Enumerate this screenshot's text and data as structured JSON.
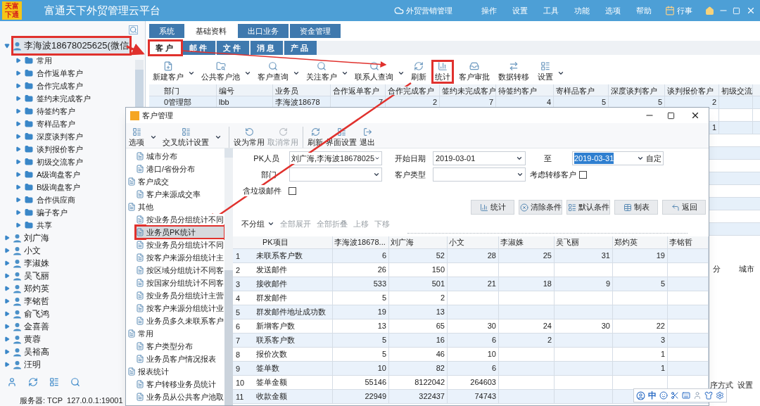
{
  "title_bar": {
    "logo": [
      "天富",
      "下通"
    ],
    "title": "富通天下外贸管理云平台",
    "cloud_link": "外贸营销管理",
    "menu": [
      "操作",
      "设置",
      "工具",
      "功能",
      "选项",
      "帮助"
    ],
    "calendar": "行事"
  },
  "sidebar": {
    "users": [
      {
        "label": "李海波18678025625(微信",
        "expanded": true,
        "annotated": true,
        "children": [
          {
            "label": "常用",
            "expanded": false
          },
          {
            "label": "合作返单客户",
            "expanded": false
          },
          {
            "label": "合作完成客户",
            "expanded": false
          },
          {
            "label": "签约未完成客户",
            "expanded": false
          },
          {
            "label": "待签约客户",
            "expanded": false
          },
          {
            "label": "寄样品客户",
            "expanded": false
          },
          {
            "label": "深度谈判客户",
            "expanded": false
          },
          {
            "label": "谈判报价客户",
            "expanded": false
          },
          {
            "label": "初级交流客户",
            "expanded": false
          },
          {
            "label": "A级询盘客户",
            "expanded": false
          },
          {
            "label": "B级询盘客户",
            "expanded": false
          },
          {
            "label": "合作供应商",
            "expanded": false
          },
          {
            "label": "骗子客户",
            "expanded": false
          },
          {
            "label": "共享",
            "expanded": false
          }
        ]
      },
      {
        "label": "刘广海",
        "expanded": false,
        "annotated": false
      },
      {
        "label": "小文",
        "expanded": false,
        "annotated": false
      },
      {
        "label": "李淑姝",
        "expanded": false,
        "annotated": false
      },
      {
        "label": "吴飞丽",
        "expanded": false,
        "annotated": false
      },
      {
        "label": "郑灼英",
        "expanded": false,
        "annotated": false
      },
      {
        "label": "李铭哲",
        "expanded": false,
        "annotated": false
      },
      {
        "label": "俞飞鸿",
        "expanded": false,
        "annotated": false
      },
      {
        "label": "金喜善",
        "expanded": false,
        "annotated": false
      },
      {
        "label": "黄蓉",
        "expanded": false,
        "annotated": false
      },
      {
        "label": "吴裕高",
        "expanded": false,
        "annotated": false
      },
      {
        "label": "汪明",
        "expanded": false,
        "annotated": false
      }
    ],
    "server": "服务器: TCP  127.0.0.1:19001"
  },
  "main_tabs": [
    {
      "label": "系统",
      "selected": false
    },
    {
      "label": "基础资料",
      "selected": true
    },
    {
      "label": "出口业务",
      "selected": false
    },
    {
      "label": "资金管理",
      "selected": false
    }
  ],
  "sub_tabs": [
    {
      "label": "客户",
      "selected": true,
      "annotated": true
    },
    {
      "label": "邮件",
      "selected": false,
      "annotated": false
    },
    {
      "label": "文件",
      "selected": false,
      "annotated": false
    },
    {
      "label": "消息",
      "selected": false,
      "annotated": false
    },
    {
      "label": "产品",
      "selected": false,
      "annotated": false
    }
  ],
  "toolbar": [
    {
      "label": "新建客户",
      "dropdown": true,
      "annotated": false
    },
    {
      "label": "公共客户池",
      "dropdown": true,
      "annotated": false
    },
    {
      "label": "客户查询",
      "dropdown": true,
      "annotated": false
    },
    {
      "label": "关注客户",
      "dropdown": true,
      "annotated": false
    },
    {
      "label": "联系人查询",
      "dropdown": true,
      "annotated": false
    },
    {
      "label": "刷新",
      "dropdown": false,
      "annotated": false
    },
    {
      "label": "统计",
      "dropdown": false,
      "annotated": true
    },
    {
      "label": "客户审批",
      "dropdown": false,
      "annotated": false
    },
    {
      "label": "数据转移",
      "dropdown": false,
      "annotated": false
    },
    {
      "label": "设置",
      "dropdown": true,
      "annotated": false
    }
  ],
  "table": {
    "columns": [
      "部门",
      "编号",
      "业务员",
      "合作返单客户",
      "合作完成客户",
      "签约未完成客户",
      "待签约客户",
      "寄样品客户",
      "深度谈判客户",
      "谈判报价客户",
      "初级交流"
    ],
    "rows": [
      {
        "cells": [
          "0管理部",
          "lbb",
          "李海波18678",
          "7",
          "2",
          "7",
          "4",
          "5",
          "5",
          "2",
          null
        ]
      },
      {
        "cells": [
          null,
          null,
          null,
          null,
          null,
          null,
          null,
          null,
          null,
          null,
          null
        ]
      },
      {
        "cells": [
          null,
          null,
          null,
          null,
          null,
          null,
          null,
          null,
          null,
          "1",
          null
        ]
      }
    ]
  },
  "lower_panel": {
    "columns": [
      "分",
      "城市"
    ],
    "footer": [
      "序方式",
      "设置"
    ]
  },
  "dialog": {
    "title": "客户管理",
    "toolbar": [
      {
        "label": "选项",
        "dropdown": true,
        "disabled": false,
        "separator": false
      },
      {
        "label": "交叉统计设置",
        "dropdown": true,
        "disabled": false,
        "separator": false
      },
      {
        "label": "设为常用",
        "dropdown": false,
        "disabled": false,
        "separator": true
      },
      {
        "label": "取消常用",
        "dropdown": false,
        "disabled": true,
        "separator": false
      },
      {
        "label": "刷新",
        "dropdown": false,
        "disabled": false,
        "separator": true
      },
      {
        "label": "界面设置",
        "dropdown": false,
        "disabled": false,
        "separator": false
      },
      {
        "label": "退出",
        "dropdown": false,
        "disabled": false,
        "separator": false
      }
    ],
    "report_tree": [
      {
        "children": [
          {
            "label": "城市分布",
            "selected": false,
            "annotated": false
          },
          {
            "label": "港口/省份分布",
            "selected": false,
            "annotated": false
          }
        ]
      },
      {
        "label": "客户成交",
        "children": [
          {
            "label": "客户来源成交率",
            "selected": false,
            "annotated": false
          }
        ]
      },
      {
        "label": "其他",
        "children": [
          {
            "label": "按业务员分组统计不同",
            "selected": false,
            "annotated": false
          },
          {
            "label": "业务员PK统计",
            "selected": true,
            "annotated": true
          },
          {
            "label": "按业务员分组统计不同",
            "selected": false,
            "annotated": false
          },
          {
            "label": "按客户来源分组统计主",
            "selected": false,
            "annotated": false
          },
          {
            "label": "按区域分组统计不同客",
            "selected": false,
            "annotated": false
          },
          {
            "label": "按国家分组统计不同客",
            "selected": false,
            "annotated": false
          },
          {
            "label": "按业务员分组统计主营",
            "selected": false,
            "annotated": false
          },
          {
            "label": "按客户来源分组统计业",
            "selected": false,
            "annotated": false
          },
          {
            "label": "业务员多久未联系客户",
            "selected": false,
            "annotated": false
          }
        ]
      },
      {
        "label": "常用",
        "children": [
          {
            "label": "客户类型分布",
            "selected": false,
            "annotated": false
          },
          {
            "label": "业务员客户情况报表",
            "selected": false,
            "annotated": false
          }
        ]
      },
      {
        "label": "报表统计",
        "children": [
          {
            "label": "客户转移业务员统计",
            "selected": false,
            "annotated": false
          },
          {
            "label": "业务员从公共客户池取",
            "selected": false,
            "annotated": false
          }
        ]
      }
    ],
    "form": {
      "pk_label": "PK人员",
      "pk_value": "刘广海,李海波18678025",
      "start_label": "开始日期",
      "start_value": "2019-03-01",
      "end_label": "至",
      "end_value": "2019-03-31",
      "end_selected": true,
      "custom": "自定",
      "dept_label": "部门",
      "type_label": "客户类型",
      "transfer_label": "考虑转移客户",
      "transfer_checked": false,
      "spam_label": "含垃圾邮件",
      "spam_checked": false
    },
    "buttons": [
      "统计",
      "清除条件",
      "默认条件",
      "制表",
      "返回"
    ],
    "group_bar": [
      {
        "label": "不分组",
        "dropdown": true,
        "disabled": false
      },
      {
        "label": "全部展开",
        "dropdown": false,
        "disabled": true
      },
      {
        "label": "全部折叠",
        "dropdown": false,
        "disabled": true
      },
      {
        "label": "上移",
        "dropdown": false,
        "disabled": true
      },
      {
        "label": "下移",
        "dropdown": false,
        "disabled": true
      }
    ],
    "grid": {
      "columns": [
        "PK项目",
        "李海波18678...",
        "刘广海",
        "小文",
        "李淑姝",
        "吴飞丽",
        "郑灼英",
        "李铭哲"
      ],
      "rows": [
        {
          "num": "1",
          "cells": [
            "未联系客户数",
            "6",
            "52",
            "28",
            "25",
            "31",
            "19",
            null
          ]
        },
        {
          "num": "2",
          "cells": [
            "发送邮件",
            "26",
            "150",
            null,
            null,
            null,
            null,
            null
          ]
        },
        {
          "num": "3",
          "cells": [
            "接收邮件",
            "533",
            "501",
            "21",
            "18",
            "9",
            "5",
            null
          ]
        },
        {
          "num": "4",
          "cells": [
            "群发邮件",
            "5",
            "2",
            null,
            null,
            null,
            null,
            null
          ]
        },
        {
          "num": "5",
          "cells": [
            "群发邮件地址成功数",
            "19",
            "13",
            null,
            null,
            null,
            null,
            null
          ]
        },
        {
          "num": "6",
          "cells": [
            "新增客户数",
            "13",
            "65",
            "30",
            "24",
            "30",
            "22",
            null
          ]
        },
        {
          "num": "7",
          "cells": [
            "联系客户数",
            "5",
            "16",
            "6",
            "2",
            null,
            "3",
            null
          ]
        },
        {
          "num": "8",
          "cells": [
            "报价次数",
            "5",
            "46",
            "10",
            null,
            null,
            "1",
            null
          ]
        },
        {
          "num": "9",
          "cells": [
            "签单数",
            "10",
            "82",
            "6",
            null,
            null,
            "1",
            null
          ]
        },
        {
          "num": "10",
          "cells": [
            "签单金额",
            "55146",
            "8122042",
            "264603",
            null,
            null,
            null,
            null
          ]
        },
        {
          "num": "11",
          "cells": [
            "收款金额",
            "22949",
            "322437",
            "74743",
            null,
            null,
            null,
            null
          ]
        }
      ]
    }
  },
  "ime": {
    "mode": "中"
  }
}
